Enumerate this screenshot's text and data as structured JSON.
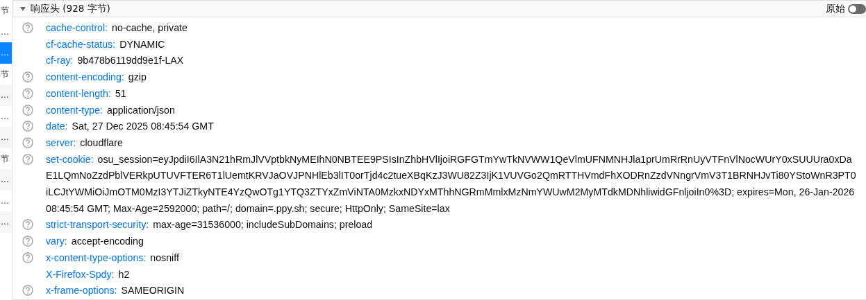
{
  "sidebar": {
    "items": [
      {
        "label": "节",
        "selected": false
      },
      {
        "label": "…",
        "selected": false
      },
      {
        "label": "…",
        "selected": true
      },
      {
        "label": "节",
        "selected": false
      },
      {
        "label": "…",
        "selected": false
      },
      {
        "label": "…",
        "selected": false
      },
      {
        "label": "…",
        "selected": false
      },
      {
        "label": "节",
        "selected": false
      },
      {
        "label": "…",
        "selected": false
      },
      {
        "label": "…",
        "selected": false
      },
      {
        "label": "…",
        "selected": false
      }
    ]
  },
  "section": {
    "title": "响应头 (928 字节)",
    "expanded": true,
    "raw_label": "原始",
    "raw_on": false,
    "headers": [
      {
        "name": "cache-control:",
        "value": "no-cache, private",
        "help": true
      },
      {
        "name": "cf-cache-status:",
        "value": "DYNAMIC",
        "help": false
      },
      {
        "name": "cf-ray:",
        "value": "9b478b6119dd9e1f-LAX",
        "help": false
      },
      {
        "name": "content-encoding:",
        "value": "gzip",
        "help": true
      },
      {
        "name": "content-length:",
        "value": "51",
        "help": true
      },
      {
        "name": "content-type:",
        "value": "application/json",
        "help": true
      },
      {
        "name": "date:",
        "value": "Sat, 27 Dec 2025 08:45:54 GMT",
        "help": true
      },
      {
        "name": "server:",
        "value": "cloudflare",
        "help": true
      },
      {
        "name": "set-cookie:",
        "value": "osu_session=eyJpdiI6IlA3N21hRmJlVVptbkNyMEIhN0NBTEE9PSIsInZhbHVlIjoiRGFGTmYwTkNVWW1QeVlmUFNMNHJla1prUmRrRnUyVTFnVlNocWUrY0xSUUUra0xDaE1LQmNoZzdPblVERkpUTUVFTER6T1lUemtKRVJaOVJPNHlEb3lIT0orTjd4c2tueXBqKzJ3WU82Z3IjK1VUVGo2QmRTTHVmdFhXODRnZzdVNngrVmV3T1BRNHJvTi80YStoWnR3PT0iLCJtYWMiOiJmOTM0MzI3YTJiZTkyNTE4YzQwOTg1YTQ3ZTYxZmViNTA0MzkxNDYxMThhNGRmMmlxMzNmYWUwM2MyMTdkMDNhliwidGFnljoiIn0%3D; expires=Mon, 26-Jan-2026 08:45:54 GMT; Max-Age=2592000; path=/; domain=.ppy.sh; secure; HttpOnly; SameSite=lax",
        "help": true
      },
      {
        "name": "strict-transport-security:",
        "value": "max-age=31536000; includeSubDomains; preload",
        "help": true
      },
      {
        "name": "vary:",
        "value": "accept-encoding",
        "help": true
      },
      {
        "name": "x-content-type-options:",
        "value": "nosniff",
        "help": true
      },
      {
        "name": "X-Firefox-Spdy:",
        "value": "h2",
        "help": false
      },
      {
        "name": "x-frame-options:",
        "value": "SAMEORIGIN",
        "help": true
      }
    ]
  }
}
